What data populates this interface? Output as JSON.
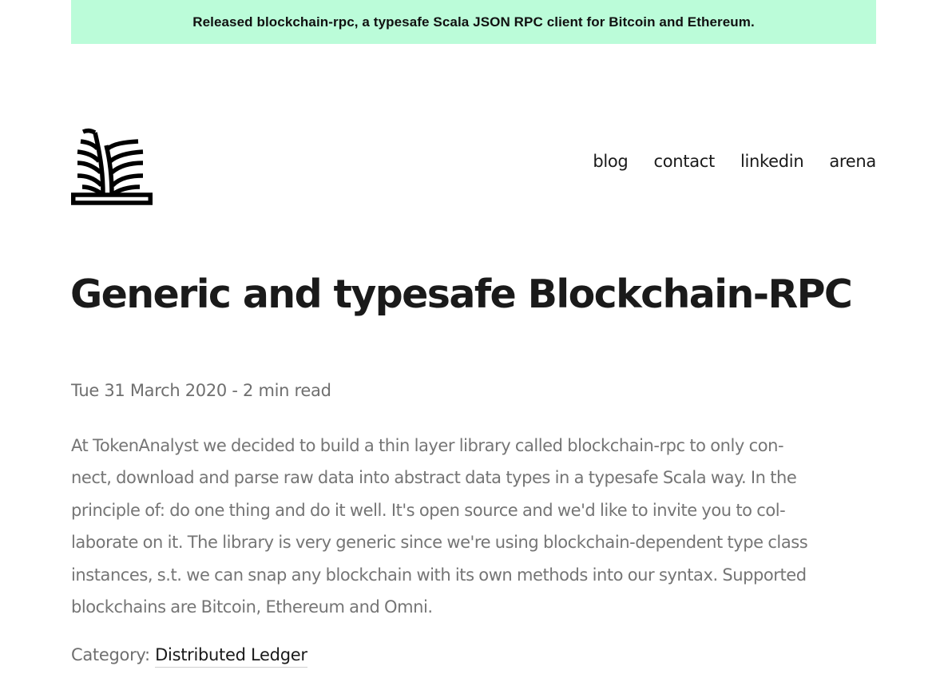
{
  "banner": {
    "text": "Released blockchain-rpc, a typesafe Scala JSON RPC client for Bitcoin and Ethereum.",
    "background": "#bbfcd9"
  },
  "logo": {
    "icon": "plant-sprout-icon"
  },
  "nav": {
    "items": [
      {
        "label": "blog"
      },
      {
        "label": "contact"
      },
      {
        "label": "linkedin"
      },
      {
        "label": "arena"
      }
    ]
  },
  "article": {
    "title": "Generic and typesafe Blockchain-RPC",
    "meta": "Tue 31 March 2020 - 2 min read",
    "body_lines": [
      "At TokenAnalyst we decided to build a thin layer library called blockchain-rpc to only con-",
      "nect, download and parse raw data into abstract data types in a typesafe Scala way. In the",
      "principle of: do one thing and do it well. It's open source and we'd like to invite you to col-",
      "laborate on it. The library is very generic since we're using blockchain-dependent type class",
      "instances, s.t. we can snap any blockchain with its own methods into our syntax. Supported",
      "blockchains are Bitcoin, Ethereum and Omni."
    ],
    "category_label": "Category:",
    "category_value": "Distributed Ledger"
  }
}
